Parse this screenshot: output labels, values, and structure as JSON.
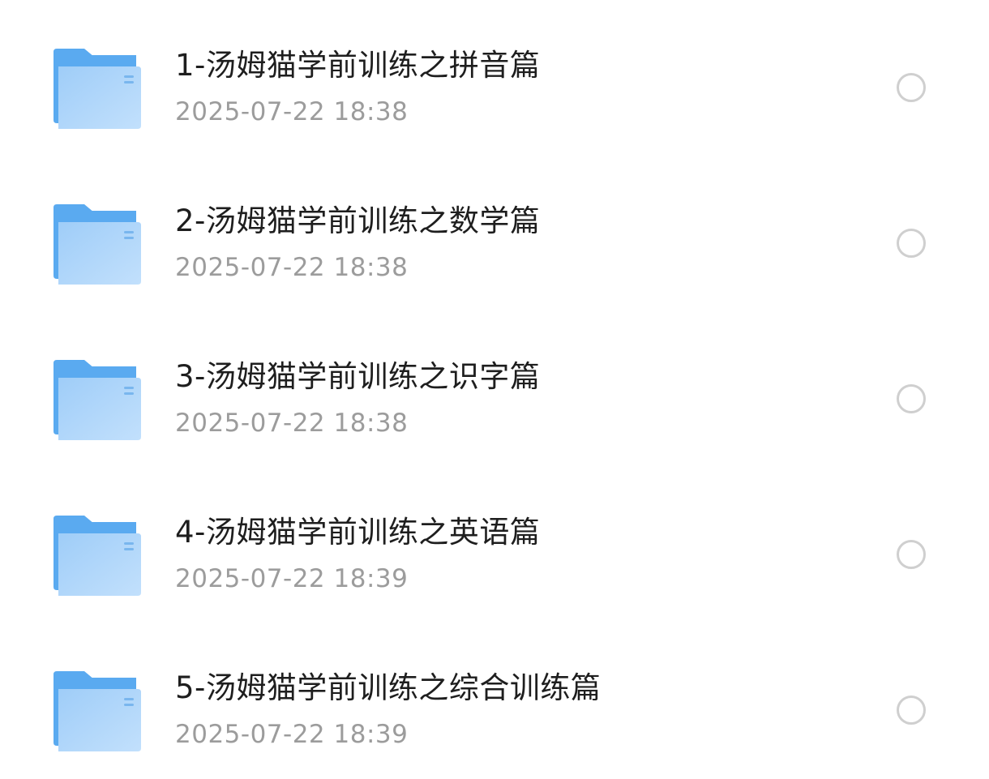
{
  "files": [
    {
      "name": "1-汤姆猫学前训练之拼音篇",
      "date": "2025-07-22 18:38",
      "icon": "folder-icon",
      "selected": false
    },
    {
      "name": "2-汤姆猫学前训练之数学篇",
      "date": "2025-07-22 18:38",
      "icon": "folder-icon",
      "selected": false
    },
    {
      "name": "3-汤姆猫学前训练之识字篇",
      "date": "2025-07-22 18:38",
      "icon": "folder-icon",
      "selected": false
    },
    {
      "name": "4-汤姆猫学前训练之英语篇",
      "date": "2025-07-22 18:39",
      "icon": "folder-icon",
      "selected": false
    },
    {
      "name": "5-汤姆猫学前训练之综合训练篇",
      "date": "2025-07-22 18:39",
      "icon": "folder-icon",
      "selected": false
    }
  ],
  "colors": {
    "folder_back": "#5aaaf0",
    "folder_front_light": "#b9dcfb",
    "folder_front_dark": "#8fc4f5",
    "title_text": "#1e1e1e",
    "date_text": "#9c9c9c",
    "radio_border": "#cfcfcf"
  }
}
